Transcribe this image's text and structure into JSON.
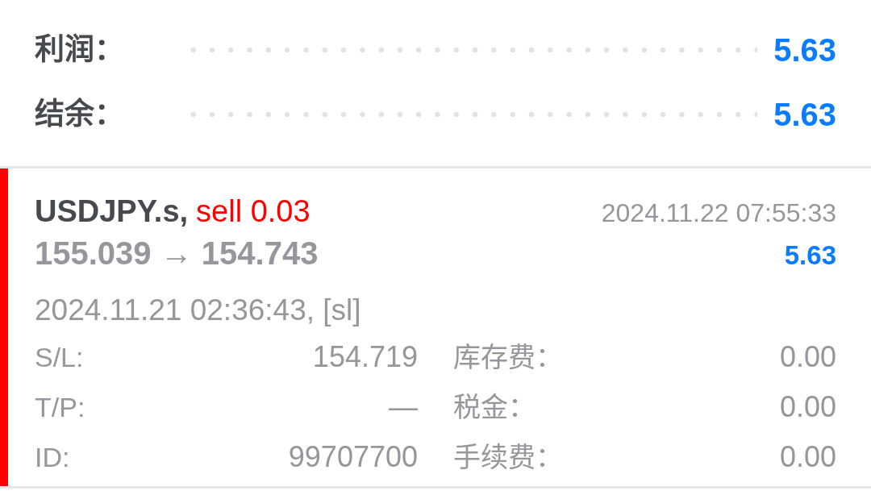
{
  "summary": [
    {
      "label": "利润：",
      "value": "5.63"
    },
    {
      "label": "结余：",
      "value": "5.63"
    }
  ],
  "trades": [
    {
      "color": "#ff0000",
      "symbol": "USDJPY.s,",
      "action": "sell 0.03",
      "close_time": "2024.11.22 07:55:33",
      "prices": "155.039 → 154.743",
      "profit": "5.63",
      "open_info": "2024.11.21 02:36:43, [sl]",
      "details": [
        {
          "label": "S/L:",
          "value": "154.719"
        },
        {
          "label": "库存费：",
          "value": "0.00"
        },
        {
          "label": "T/P:",
          "value": "—"
        },
        {
          "label": "税金：",
          "value": "0.00"
        },
        {
          "label": "ID:",
          "value": "99707700"
        },
        {
          "label": "手续费：",
          "value": "0.00"
        }
      ]
    }
  ]
}
